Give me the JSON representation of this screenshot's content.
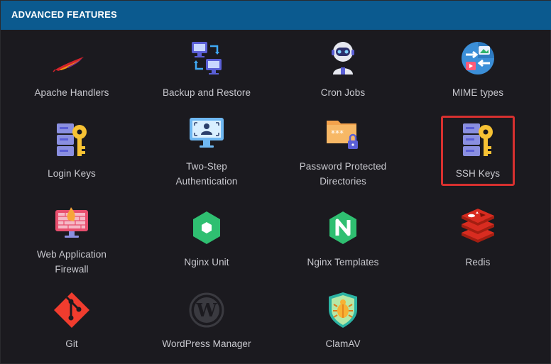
{
  "header": {
    "title": "ADVANCED FEATURES"
  },
  "items": [
    {
      "label": "Apache Handlers",
      "icon": "feather-icon"
    },
    {
      "label": "Backup and Restore",
      "icon": "sync-monitors-icon"
    },
    {
      "label": "Cron Jobs",
      "icon": "robot-icon"
    },
    {
      "label": "MIME types",
      "icon": "arrows-circle-icon"
    },
    {
      "label": "Login Keys",
      "icon": "server-key-icon"
    },
    {
      "label": "Two-Step\nAuthentication",
      "icon": "monitor-user-icon"
    },
    {
      "label": "Password Protected\nDirectories",
      "icon": "locked-folder-icon"
    },
    {
      "label": "SSH Keys",
      "icon": "server-key-icon",
      "selected": true
    },
    {
      "label": "Web Application\nFirewall",
      "icon": "firewall-icon"
    },
    {
      "label": "Nginx Unit",
      "icon": "green-hexagon-icon"
    },
    {
      "label": "Nginx Templates",
      "icon": "nginx-n-icon"
    },
    {
      "label": "Redis",
      "icon": "redis-stack-icon"
    },
    {
      "label": "Git",
      "icon": "git-icon"
    },
    {
      "label": "WordPress Manager",
      "icon": "wordpress-icon"
    },
    {
      "label": "ClamAV",
      "icon": "shield-bug-icon"
    }
  ],
  "colors": {
    "header_bg": "#0b5a8f",
    "panel_bg": "#1b1a1f",
    "label": "#c9c9cf",
    "selection_border": "#d7302f"
  }
}
